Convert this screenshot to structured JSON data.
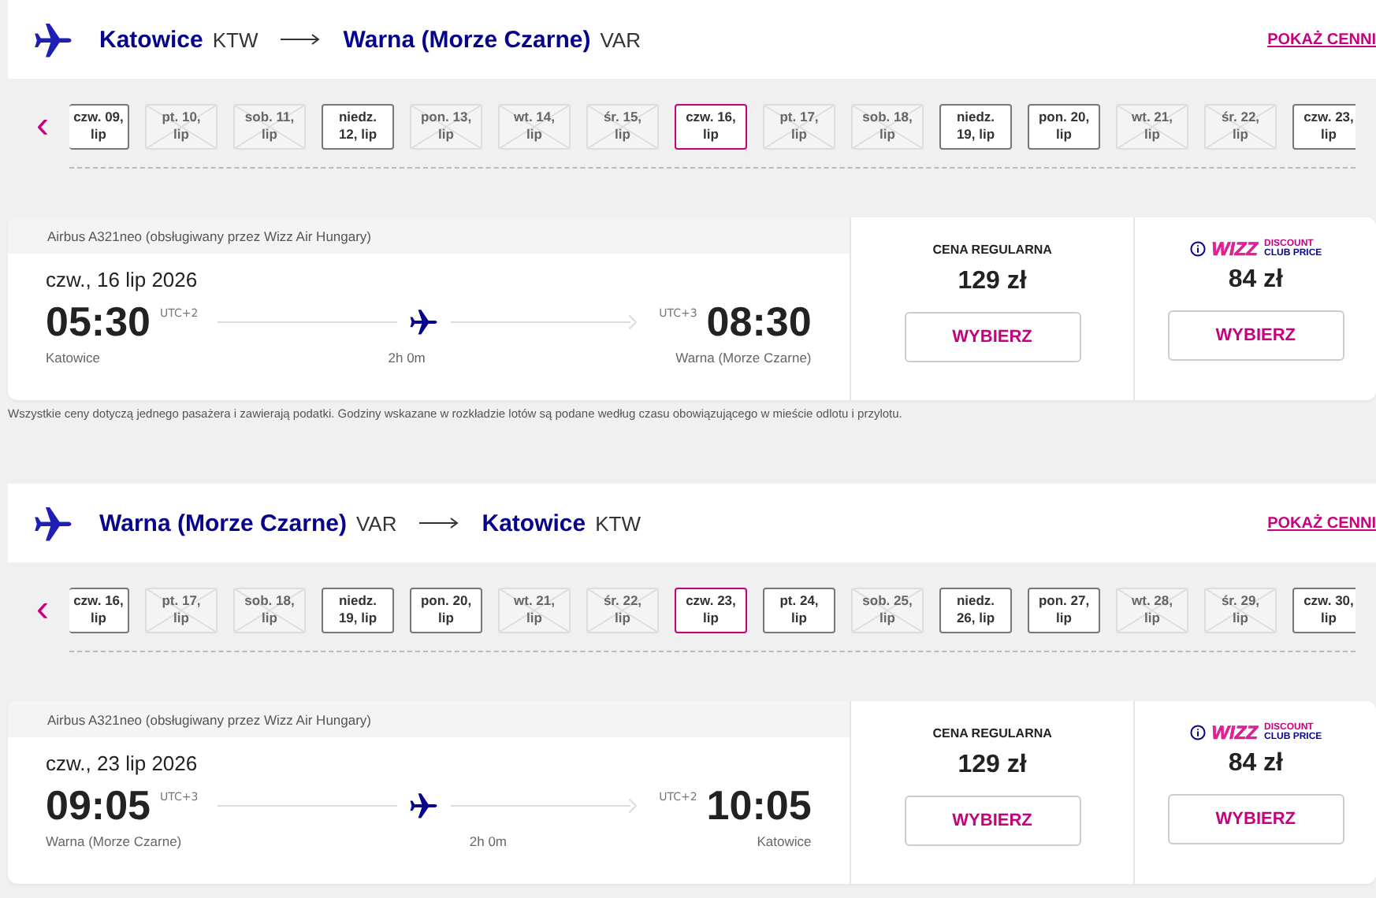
{
  "legs": [
    {
      "origin": {
        "city": "Katowice",
        "code": "KTW"
      },
      "destination": {
        "city": "Warna (Morze Czarne)",
        "code": "VAR"
      },
      "price_link": "POKAŻ CENNI",
      "prev": "‹",
      "dates": [
        {
          "lines": [
            "czw. 09,",
            "lip"
          ],
          "available": true,
          "selected": false
        },
        {
          "lines": [
            "pt. 10,",
            "lip"
          ],
          "available": false,
          "selected": false
        },
        {
          "lines": [
            "sob. 11,",
            "lip"
          ],
          "available": false,
          "selected": false
        },
        {
          "lines": [
            "niedz.",
            "12, lip"
          ],
          "available": true,
          "selected": false
        },
        {
          "lines": [
            "pon. 13,",
            "lip"
          ],
          "available": false,
          "selected": false
        },
        {
          "lines": [
            "wt. 14,",
            "lip"
          ],
          "available": false,
          "selected": false
        },
        {
          "lines": [
            "śr. 15,",
            "lip"
          ],
          "available": false,
          "selected": false
        },
        {
          "lines": [
            "czw. 16,",
            "lip"
          ],
          "available": true,
          "selected": true
        },
        {
          "lines": [
            "pt. 17,",
            "lip"
          ],
          "available": false,
          "selected": false
        },
        {
          "lines": [
            "sob. 18,",
            "lip"
          ],
          "available": false,
          "selected": false
        },
        {
          "lines": [
            "niedz.",
            "19, lip"
          ],
          "available": true,
          "selected": false
        },
        {
          "lines": [
            "pon. 20,",
            "lip"
          ],
          "available": true,
          "selected": false
        },
        {
          "lines": [
            "wt. 21,",
            "lip"
          ],
          "available": false,
          "selected": false
        },
        {
          "lines": [
            "śr. 22,",
            "lip"
          ],
          "available": false,
          "selected": false
        },
        {
          "lines": [
            "czw. 23,",
            "lip"
          ],
          "available": true,
          "selected": false
        }
      ],
      "flight": {
        "aircraft": "Airbus A321neo (obsługiwany przez Wizz Air Hungary)",
        "date": "czw., 16 lip 2026",
        "departure": "05:30",
        "departure_tz": "UTC+2",
        "arrival": "08:30",
        "arrival_tz": "UTC+3",
        "duration": "2h 0m",
        "from": "Katowice",
        "to": "Warna (Morze Czarne)",
        "regular": {
          "label": "CENA REGULARNA",
          "price": "129 zł",
          "button": "WYBIERZ"
        },
        "discount": {
          "brand": "WIZZ",
          "label_top": "DISCOUNT",
          "label_bottom": "CLUB PRICE",
          "price": "84 zł",
          "button": "WYBIERZ"
        }
      },
      "note": "Wszystkie ceny dotyczą jednego pasażera i zawierają podatki. Godziny wskazane w rozkładzie lotów są podane według czasu obowiązującego w mieście odlotu i przylotu."
    },
    {
      "origin": {
        "city": "Warna (Morze Czarne)",
        "code": "VAR"
      },
      "destination": {
        "city": "Katowice",
        "code": "KTW"
      },
      "price_link": "POKAŻ CENNI",
      "prev": "‹",
      "dates": [
        {
          "lines": [
            "czw. 16,",
            "lip"
          ],
          "available": true,
          "selected": false
        },
        {
          "lines": [
            "pt. 17,",
            "lip"
          ],
          "available": false,
          "selected": false
        },
        {
          "lines": [
            "sob. 18,",
            "lip"
          ],
          "available": false,
          "selected": false
        },
        {
          "lines": [
            "niedz.",
            "19, lip"
          ],
          "available": true,
          "selected": false
        },
        {
          "lines": [
            "pon. 20,",
            "lip"
          ],
          "available": true,
          "selected": false
        },
        {
          "lines": [
            "wt. 21,",
            "lip"
          ],
          "available": false,
          "selected": false
        },
        {
          "lines": [
            "śr. 22,",
            "lip"
          ],
          "available": false,
          "selected": false
        },
        {
          "lines": [
            "czw. 23,",
            "lip"
          ],
          "available": true,
          "selected": true
        },
        {
          "lines": [
            "pt. 24,",
            "lip"
          ],
          "available": true,
          "selected": false
        },
        {
          "lines": [
            "sob. 25,",
            "lip"
          ],
          "available": false,
          "selected": false
        },
        {
          "lines": [
            "niedz.",
            "26, lip"
          ],
          "available": true,
          "selected": false
        },
        {
          "lines": [
            "pon. 27,",
            "lip"
          ],
          "available": true,
          "selected": false
        },
        {
          "lines": [
            "wt. 28,",
            "lip"
          ],
          "available": false,
          "selected": false
        },
        {
          "lines": [
            "śr. 29,",
            "lip"
          ],
          "available": false,
          "selected": false
        },
        {
          "lines": [
            "czw. 30,",
            "lip"
          ],
          "available": true,
          "selected": false
        }
      ],
      "flight": {
        "aircraft": "Airbus A321neo (obsługiwany przez Wizz Air Hungary)",
        "date": "czw., 23 lip 2026",
        "departure": "09:05",
        "departure_tz": "UTC+3",
        "arrival": "10:05",
        "arrival_tz": "UTC+2",
        "duration": "2h 0m",
        "from": "Warna (Morze Czarne)",
        "to": "Katowice",
        "regular": {
          "label": "CENA REGULARNA",
          "price": "129 zł",
          "button": "WYBIERZ"
        },
        "discount": {
          "brand": "WIZZ",
          "label_top": "DISCOUNT",
          "label_bottom": "CLUB PRICE",
          "price": "84 zł",
          "button": "WYBIERZ"
        }
      }
    }
  ]
}
